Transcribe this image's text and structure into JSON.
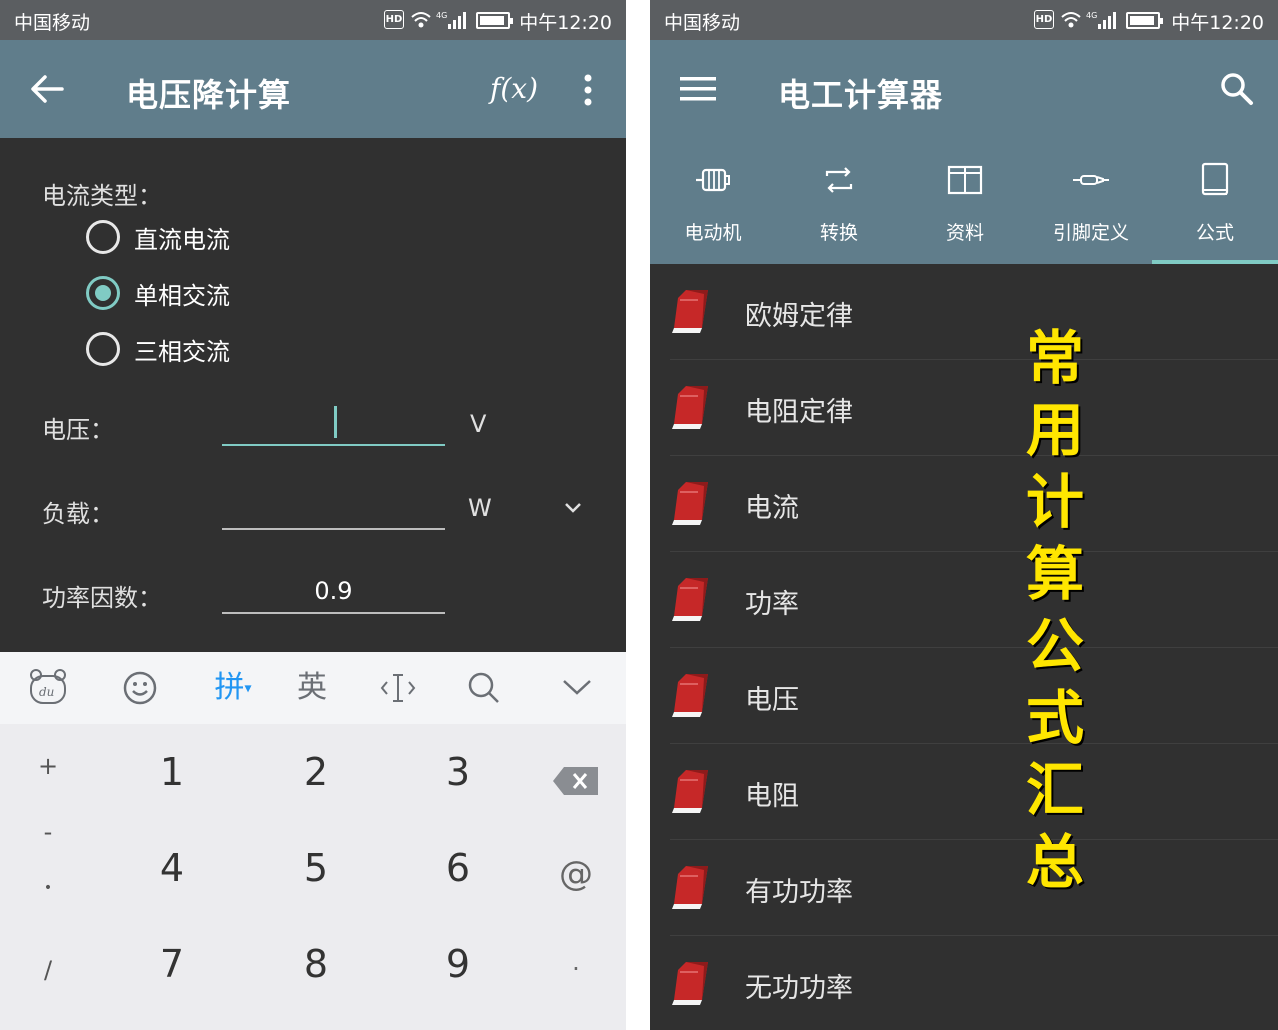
{
  "left_screen": {
    "status": {
      "carrier": "中国移动",
      "hd": "HD",
      "network": "4G",
      "time": "中午12:20"
    },
    "appbar": {
      "back_icon": "arrow-left-icon",
      "title": "电压降计算",
      "fx_label": "f(x)",
      "menu_icon": "more-vert-icon"
    },
    "form": {
      "current_type_label": "电流类型：",
      "radio_options": [
        {
          "label": "直流电流",
          "checked": false
        },
        {
          "label": "单相交流",
          "checked": true
        },
        {
          "label": "三相交流",
          "checked": false
        }
      ],
      "voltage": {
        "label": "电压：",
        "value": "",
        "unit": "V"
      },
      "load": {
        "label": "负载：",
        "value": "",
        "unit": "W"
      },
      "power_factor": {
        "label": "功率因数：",
        "value": "0.9"
      }
    },
    "keyboard": {
      "toolbar": [
        {
          "name": "du-bear-icon",
          "label": "du"
        },
        {
          "name": "emoji-icon",
          "label": "☺"
        },
        {
          "name": "pinyin-key",
          "label": "拼"
        },
        {
          "name": "english-key",
          "label": "英"
        },
        {
          "name": "cursor-move-icon",
          "label": "‹I›"
        },
        {
          "name": "search-icon",
          "label": ""
        },
        {
          "name": "collapse-icon",
          "label": ""
        }
      ],
      "side_keys": [
        "+",
        "-",
        "•",
        "/"
      ],
      "digits": [
        "1",
        "2",
        "3",
        "4",
        "5",
        "6",
        "7",
        "8",
        "9"
      ],
      "right_keys": [
        "⌫",
        "@",
        "."
      ]
    }
  },
  "right_screen": {
    "status": {
      "carrier": "中国移动",
      "hd": "HD",
      "network": "4G",
      "time": "中午12:20"
    },
    "appbar": {
      "menu_icon": "hamburger-icon",
      "title": "电工计算器",
      "search_icon": "search-icon"
    },
    "tabs": [
      {
        "label": "电动机",
        "icon": "motor-icon",
        "selected": false
      },
      {
        "label": "转换",
        "icon": "convert-icon",
        "selected": false
      },
      {
        "label": "资料",
        "icon": "book-open-icon",
        "selected": false
      },
      {
        "label": "引脚定义",
        "icon": "connector-icon",
        "selected": false
      },
      {
        "label": "公式",
        "icon": "book-icon",
        "selected": true
      }
    ],
    "list": [
      "欧姆定律",
      "电阻定律",
      "电流",
      "功率",
      "电压",
      "电阻",
      "有功功率",
      "无功功率"
    ],
    "overlay": [
      "常",
      "用",
      "计",
      "算",
      "公",
      "式",
      "汇",
      "总"
    ]
  },
  "colors": {
    "appbar": "#607d8b",
    "accent": "#80cbc4",
    "background": "#303030",
    "overlay": "#ffe600"
  }
}
